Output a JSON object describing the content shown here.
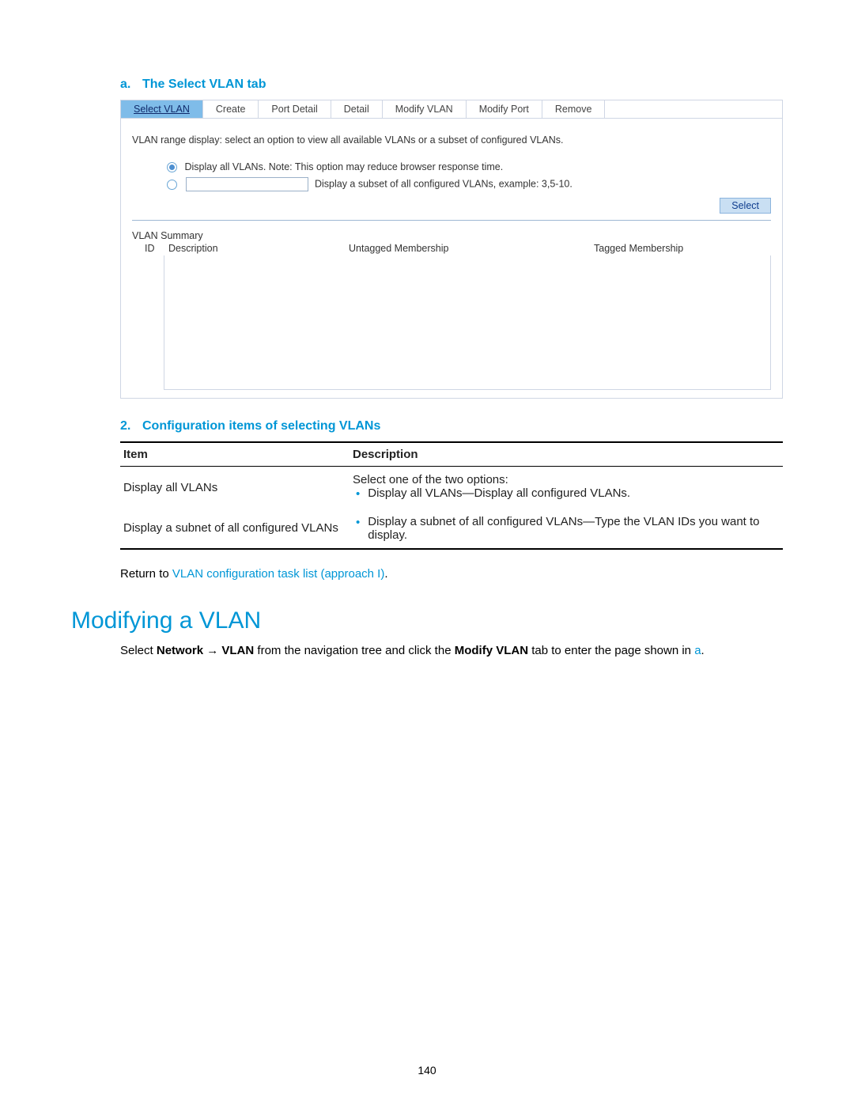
{
  "sectionA": {
    "marker": "a.",
    "title": "The Select VLAN tab"
  },
  "screenshot": {
    "tabs": [
      "Select VLAN",
      "Create",
      "Port Detail",
      "Detail",
      "Modify VLAN",
      "Modify Port",
      "Remove"
    ],
    "desc": "VLAN range display: select an option to view all available VLANs or a subset of configured VLANs.",
    "opt1": "Display all VLANs. Note: This option may reduce browser response time.",
    "opt2": "Display a subset of all configured VLANs, example: 3,5-10.",
    "selectBtn": "Select",
    "summaryTitle": "VLAN Summary",
    "cols": {
      "id": "ID",
      "desc": "Description",
      "untag": "Untagged Membership",
      "tag": "Tagged Membership"
    }
  },
  "section2": {
    "marker": "2.",
    "title": "Configuration items of selecting VLANs"
  },
  "cfgTable": {
    "head": {
      "item": "Item",
      "desc": "Description"
    },
    "rows": [
      {
        "item": "Display all VLANs",
        "intro": "Select one of the two options:",
        "bullet": "Display all VLANs—Display all configured VLANs."
      },
      {
        "item": "Display a subnet of all configured VLANs",
        "bullet": "Display a subnet of all configured VLANs—Type the VLAN IDs you want to display."
      }
    ]
  },
  "returnLine": {
    "prefix": "Return to ",
    "link": "VLAN configuration task list (approach I)",
    "suffix": "."
  },
  "h1": "Modifying a VLAN",
  "paragraph": {
    "p1": "Select ",
    "b1": "Network",
    "arrow": " → ",
    "b2": "VLAN",
    "p2": " from the navigation tree and click the ",
    "b3": "Modify VLAN",
    "p3": " tab to enter the page shown in ",
    "link": "a",
    "p4": "."
  },
  "pageNumber": "140"
}
